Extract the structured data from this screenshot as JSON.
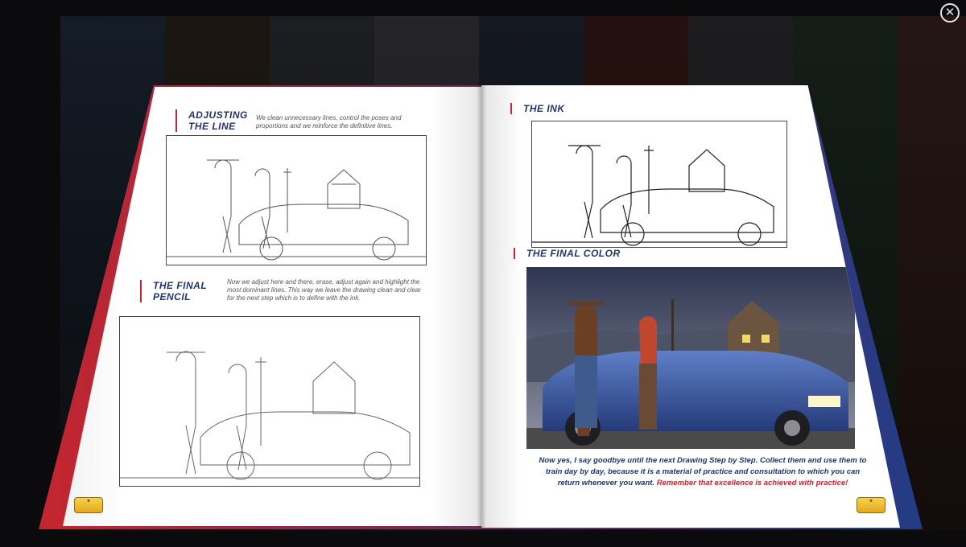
{
  "close_button": {
    "glyph": "✕"
  },
  "left_page": {
    "section1": {
      "title_line1": "ADJUSTING",
      "title_line2": "THE LINE",
      "description": "We clean unnecessary lines, control the poses and proportions and we reinforce the definitive lines."
    },
    "section2": {
      "title_line1": "THE FINAL",
      "title_line2": "PENCIL",
      "description": "Now we adjust here and there, erase, adjust again and highlight the most dominant lines. This way we leave the drawing clean and clear for the next step which is to define with the ink."
    }
  },
  "right_page": {
    "section1": {
      "title": "THE INK"
    },
    "section2": {
      "title": "THE FINAL COLOR"
    },
    "closing_text": "Now yes, I say goodbye until the next Drawing Step by Step. Collect them and use them to train day by day, because it is a material of practice and consultation to which you can return whenever you want.",
    "closing_emphasis": "Remember that excellence is achieved with practice!"
  },
  "colors": {
    "heading": "#22356b",
    "accent_red": "#c5262f",
    "accent_blue": "#213c86"
  }
}
